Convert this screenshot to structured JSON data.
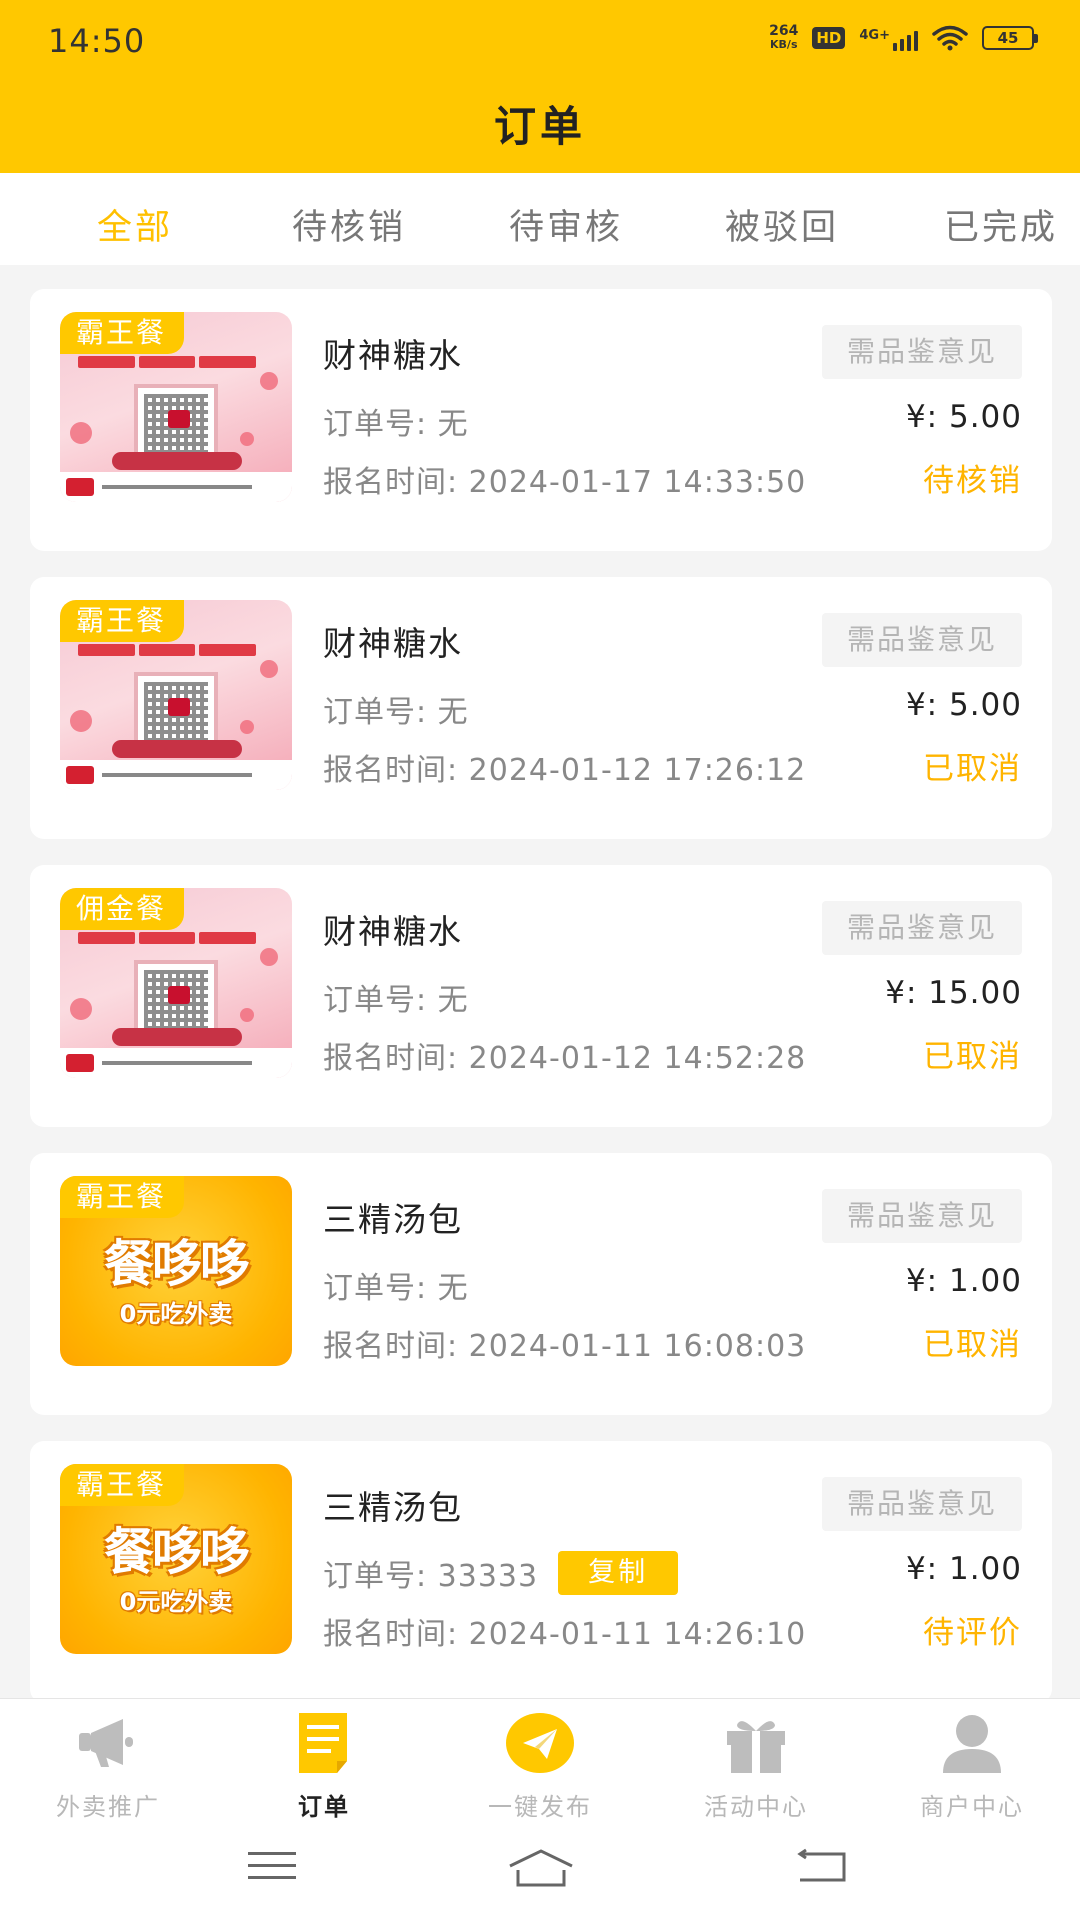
{
  "status_bar": {
    "time": "14:50",
    "net_speed_value": "264",
    "net_speed_unit": "KB/s",
    "hd": "HD",
    "network": "4G+",
    "battery": "45"
  },
  "header": {
    "title": "订单"
  },
  "tabs": [
    {
      "label": "全部",
      "active": true
    },
    {
      "label": "待核销",
      "active": false
    },
    {
      "label": "待审核",
      "active": false
    },
    {
      "label": "被驳回",
      "active": false
    },
    {
      "label": "已完成",
      "active": false
    }
  ],
  "orders": [
    {
      "tag": "霸王餐",
      "image": "qr",
      "shop": "财神糖水",
      "review_label": "需品鉴意见",
      "order_no": "订单号: 无",
      "price": "¥: 5.00",
      "signup_time": "报名时间:  2024-01-17 14:33:50",
      "status": "待核销"
    },
    {
      "tag": "霸王餐",
      "image": "qr",
      "shop": "财神糖水",
      "review_label": "需品鉴意见",
      "order_no": "订单号: 无",
      "price": "¥: 5.00",
      "signup_time": "报名时间:  2024-01-12 17:26:12",
      "status": "已取消"
    },
    {
      "tag": "佣金餐",
      "image": "qr",
      "shop": "财神糖水",
      "review_label": "需品鉴意见",
      "order_no": "订单号: 无",
      "price": "¥: 15.00",
      "signup_time": "报名时间:  2024-01-12 14:52:28",
      "status": "已取消"
    },
    {
      "tag": "霸王餐",
      "image": "promo",
      "promo_title": "餐哆哆",
      "promo_sub": "0元吃外卖",
      "shop": "三精汤包",
      "review_label": "需品鉴意见",
      "order_no": "订单号: 无",
      "price": "¥: 1.00",
      "signup_time": "报名时间:  2024-01-11 16:08:03",
      "status": "已取消"
    },
    {
      "tag": "霸王餐",
      "image": "promo",
      "promo_title": "餐哆哆",
      "promo_sub": "0元吃外卖",
      "shop": "三精汤包",
      "review_label": "需品鉴意见",
      "order_no": "订单号: 33333",
      "copy_label": "复制",
      "price": "¥: 1.00",
      "signup_time": "报名时间:  2024-01-11 14:26:10",
      "status": "待评价"
    }
  ],
  "bottom_nav": [
    {
      "label": "外卖推广",
      "icon": "megaphone-icon",
      "active": false
    },
    {
      "label": "订单",
      "icon": "order-list-icon",
      "active": true
    },
    {
      "label": "一键发布",
      "icon": "paper-plane-icon",
      "active": false
    },
    {
      "label": "活动中心",
      "icon": "gift-icon",
      "active": false
    },
    {
      "label": "商户中心",
      "icon": "user-icon",
      "active": false
    }
  ],
  "colors": {
    "brand": "#ffc800",
    "status": "#ffb400",
    "inactive": "#b8b8b8"
  }
}
